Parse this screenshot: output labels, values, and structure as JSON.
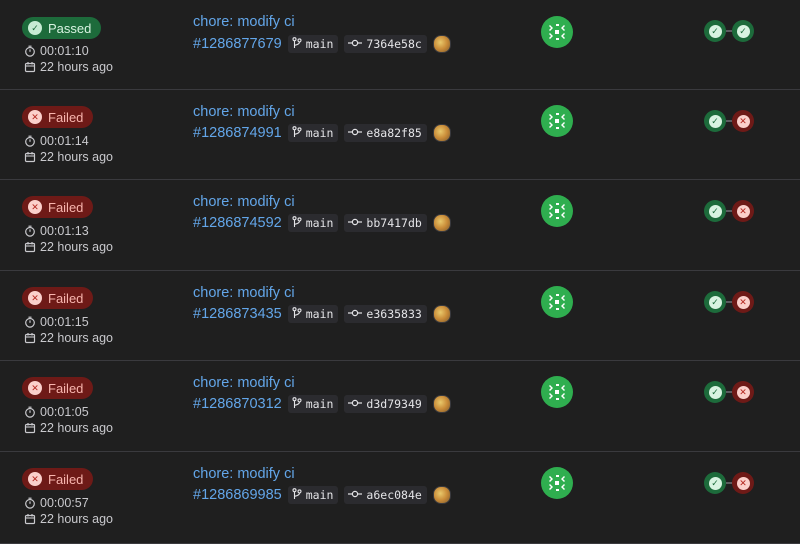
{
  "colors": {
    "background": "#1f1f1f",
    "link": "#63a6e9",
    "success": "#1d6b3b",
    "failed": "#6e1a17",
    "avatar": "#2fae4f"
  },
  "icons": {
    "duration": "stopwatch-icon",
    "date": "calendar-icon",
    "branch": "branch-icon",
    "commit": "commit-icon",
    "passed": "check-icon",
    "failed": "x-icon"
  },
  "pipelines": [
    {
      "status": "success",
      "status_label": "Passed",
      "duration": "00:01:10",
      "finished": "22 hours ago",
      "commit_title": "chore: modify ci",
      "pipeline_id": "#1286877679",
      "branch": "main",
      "sha": "7364e58c",
      "stages": [
        "success",
        "success"
      ]
    },
    {
      "status": "failed",
      "status_label": "Failed",
      "duration": "00:01:14",
      "finished": "22 hours ago",
      "commit_title": "chore: modify ci",
      "pipeline_id": "#1286874991",
      "branch": "main",
      "sha": "e8a82f85",
      "stages": [
        "success",
        "failed"
      ]
    },
    {
      "status": "failed",
      "status_label": "Failed",
      "duration": "00:01:13",
      "finished": "22 hours ago",
      "commit_title": "chore: modify ci",
      "pipeline_id": "#1286874592",
      "branch": "main",
      "sha": "bb7417db",
      "stages": [
        "success",
        "failed"
      ]
    },
    {
      "status": "failed",
      "status_label": "Failed",
      "duration": "00:01:15",
      "finished": "22 hours ago",
      "commit_title": "chore: modify ci",
      "pipeline_id": "#1286873435",
      "branch": "main",
      "sha": "e3635833",
      "stages": [
        "success",
        "failed"
      ]
    },
    {
      "status": "failed",
      "status_label": "Failed",
      "duration": "00:01:05",
      "finished": "22 hours ago",
      "commit_title": "chore: modify ci",
      "pipeline_id": "#1286870312",
      "branch": "main",
      "sha": "d3d79349",
      "stages": [
        "success",
        "failed"
      ]
    },
    {
      "status": "failed",
      "status_label": "Failed",
      "duration": "00:00:57",
      "finished": "22 hours ago",
      "commit_title": "chore: modify ci",
      "pipeline_id": "#1286869985",
      "branch": "main",
      "sha": "a6ec084e",
      "stages": [
        "success",
        "failed"
      ]
    }
  ]
}
